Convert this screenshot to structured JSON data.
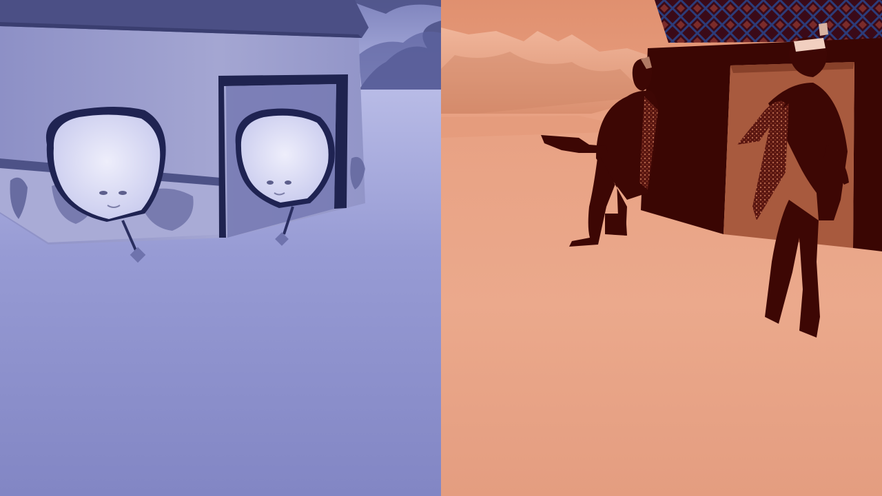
{
  "screen": {
    "layout": "split-screen",
    "players": [
      {
        "id": "player-1",
        "tint": "#8a8fd0",
        "scene": [
          "igloo-hut",
          "balloon-head-character",
          "balloon-head-character",
          "snowy-ground",
          "distant-mountains"
        ]
      },
      {
        "id": "player-2",
        "tint": "#e8a487",
        "scene": [
          "desert-mountains",
          "dark-hut",
          "humanoid-character-with-gun",
          "humanoid-character",
          "sandy-ground"
        ]
      }
    ]
  },
  "colors": {
    "left_ground": "#8c90cc",
    "left_sky": "#b9bde8",
    "left_hut": "#9a9ccc",
    "right_ground": "#e8a688",
    "right_sky": "#e39676",
    "right_dark": "#3d0704"
  }
}
